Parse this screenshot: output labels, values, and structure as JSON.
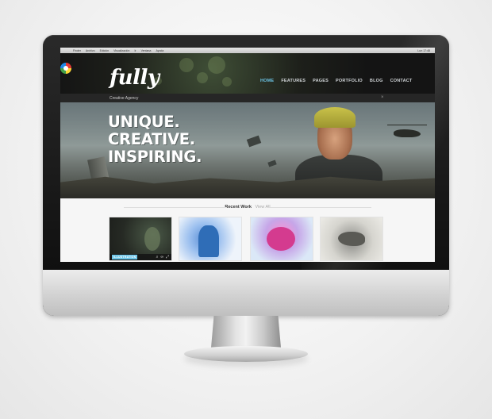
{
  "menubar": {
    "items": [
      "Finder",
      "Archivo",
      "Edición",
      "Visualización",
      "Ir",
      "Ventana",
      "Ayuda"
    ],
    "right": "Lun 17:48"
  },
  "site": {
    "logo_text": "fully",
    "nav": [
      {
        "label": "HOME",
        "active": true
      },
      {
        "label": "FEATURES",
        "active": false
      },
      {
        "label": "PAGES",
        "active": false
      },
      {
        "label": "PORTFOLIO",
        "active": false
      },
      {
        "label": "BLOG",
        "active": false
      },
      {
        "label": "CONTACT",
        "active": false
      }
    ],
    "tagline": "Creative Agency",
    "close_glyph": "×"
  },
  "hero": {
    "lines": [
      "UNIQUE.",
      "CREATIVE.",
      "INSPIRING."
    ]
  },
  "recent": {
    "title": "Recent Work",
    "link": "View All",
    "thumbs": [
      {
        "category": "ILLUSTRATION",
        "icons": [
          "search-icon",
          "link-icon",
          "expand-icon"
        ]
      },
      {
        "category": "",
        "icons": []
      },
      {
        "category": "",
        "icons": []
      },
      {
        "category": "",
        "icons": []
      }
    ]
  },
  "colors": {
    "accent": "#6cc4e6",
    "header_bg": "#141414",
    "hero_text": "#ffffff"
  }
}
